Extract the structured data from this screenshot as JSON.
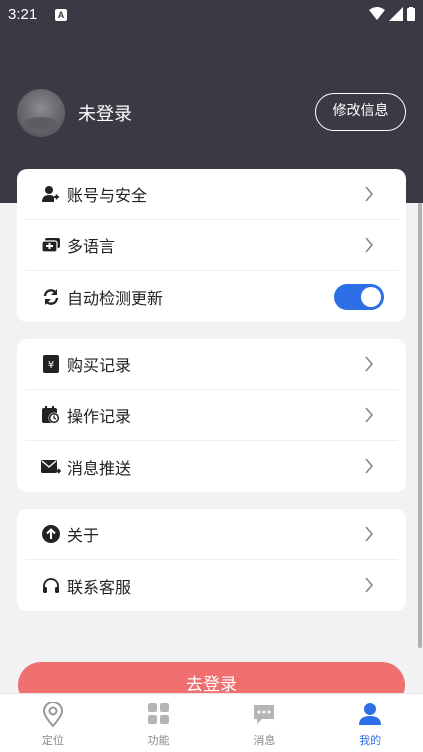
{
  "status_bar": {
    "time": "3:21",
    "notification_letter": "A"
  },
  "profile": {
    "username": "未登录",
    "edit_label": "修改信息"
  },
  "group1": [
    {
      "label": "账号与安全",
      "icon": "user-shield-icon"
    },
    {
      "label": "多语言",
      "icon": "language-icon"
    },
    {
      "label": "自动检测更新",
      "icon": "refresh-icon",
      "toggle_on": true
    }
  ],
  "group2": [
    {
      "label": "购买记录",
      "icon": "yen-receipt-icon"
    },
    {
      "label": "操作记录",
      "icon": "calendar-clock-icon"
    },
    {
      "label": "消息推送",
      "icon": "mail-forward-icon"
    }
  ],
  "group3": [
    {
      "label": "关于",
      "icon": "arrow-up-circle-icon"
    },
    {
      "label": "联系客服",
      "icon": "headset-icon"
    }
  ],
  "login_button": "去登录",
  "tabs": [
    {
      "label": "定位",
      "icon": "location-pin-icon"
    },
    {
      "label": "功能",
      "icon": "grid-icon"
    },
    {
      "label": "消息",
      "icon": "message-icon"
    },
    {
      "label": "我的",
      "icon": "person-icon",
      "active": true
    }
  ],
  "colors": {
    "header": "#3b3a44",
    "accent": "#2c6fe6",
    "login": "#f06f6f"
  }
}
